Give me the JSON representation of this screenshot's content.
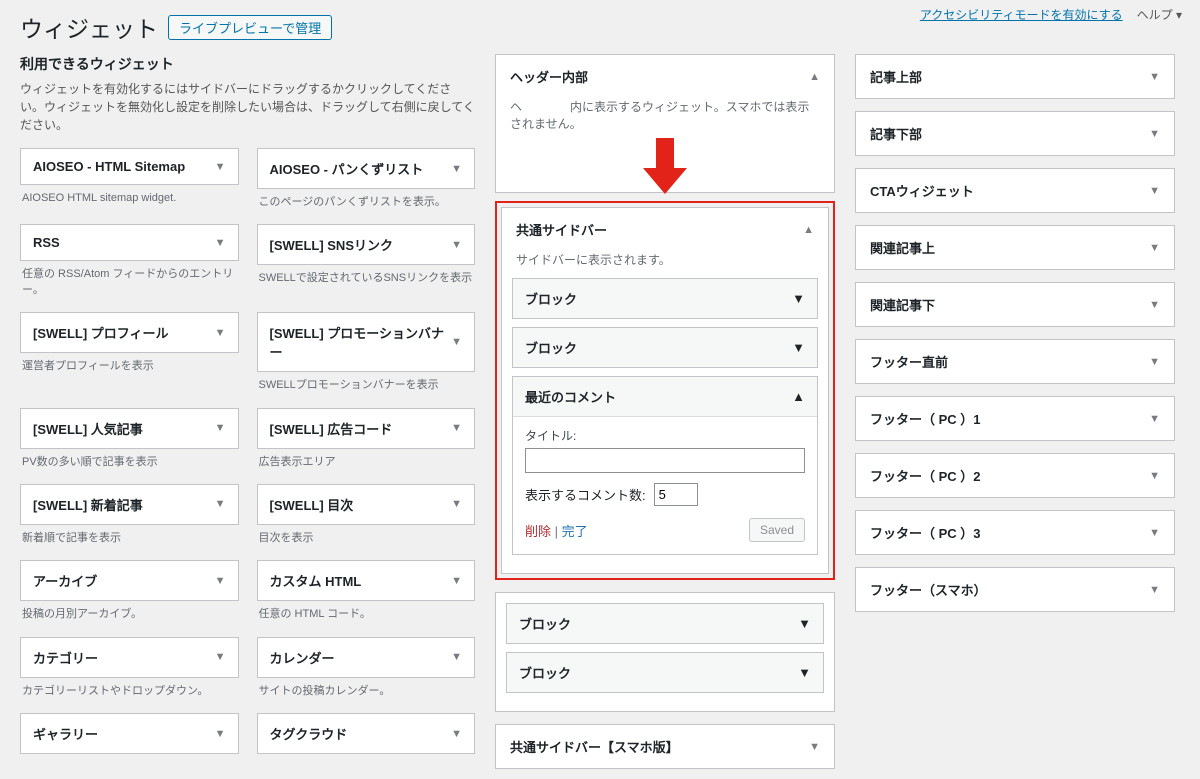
{
  "top": {
    "title": "ウィジェット",
    "live_preview": "ライブプレビューで管理",
    "a11y": "アクセシビリティモードを有効にする",
    "help": "ヘルプ ▾"
  },
  "left": {
    "subtitle": "利用できるウィジェット",
    "desc": "ウィジェットを有効化するにはサイドバーにドラッグするかクリックしてください。ウィジェットを無効化し設定を削除したい場合は、ドラッグして右側に戻してください。",
    "items": [
      {
        "label": "AIOSEO - HTML Sitemap",
        "desc": "AIOSEO HTML sitemap widget."
      },
      {
        "label": "AIOSEO - パンくずリスト",
        "desc": "このページのパンくずリストを表示。"
      },
      {
        "label": "RSS",
        "desc": "任意の RSS/Atom フィードからのエントリー。"
      },
      {
        "label": "[SWELL] SNSリンク",
        "desc": "SWELLで設定されているSNSリンクを表示"
      },
      {
        "label": "[SWELL] プロフィール",
        "desc": "運営者プロフィールを表示"
      },
      {
        "label": "[SWELL] プロモーションバナー",
        "desc": "SWELLプロモーションバナーを表示"
      },
      {
        "label": "[SWELL] 人気記事",
        "desc": "PV数の多い順で記事を表示"
      },
      {
        "label": "[SWELL] 広告コード",
        "desc": "広告表示エリア"
      },
      {
        "label": "[SWELL] 新着記事",
        "desc": "新着順で記事を表示"
      },
      {
        "label": "[SWELL] 目次",
        "desc": "目次を表示"
      },
      {
        "label": "アーカイブ",
        "desc": "投稿の月別アーカイブ。"
      },
      {
        "label": "カスタム HTML",
        "desc": "任意の HTML コード。"
      },
      {
        "label": "カテゴリー",
        "desc": "カテゴリーリストやドロップダウン。"
      },
      {
        "label": "カレンダー",
        "desc": "サイトの投稿カレンダー。"
      },
      {
        "label": "ギャラリー",
        "desc": ""
      },
      {
        "label": "タグクラウド",
        "desc": ""
      }
    ]
  },
  "mid": {
    "area0": {
      "title": "ヘッダー内部",
      "desc": "ヘ　　　　内に表示するウィジェット。スマホでは表示されません。"
    },
    "area1": {
      "title": "共通サイドバー",
      "desc": "サイドバーに表示されます。",
      "w0": "ブロック",
      "w1": "ブロック",
      "w2": {
        "title": "最近のコメント",
        "title_label": "タイトル:",
        "count_label": "表示するコメント数:",
        "count_value": "5",
        "delete": "削除",
        "done": "完了",
        "saved": "Saved"
      },
      "w3": "ブロック",
      "w4": "ブロック"
    },
    "area2": {
      "title": "共通サイドバー【スマホ版】"
    }
  },
  "right": {
    "areas": [
      "記事上部",
      "記事下部",
      "CTAウィジェット",
      "関連記事上",
      "関連記事下",
      "フッター直前",
      "フッター（ PC ）1",
      "フッター（ PC ）2",
      "フッター（ PC ）3",
      "フッター（スマホ）"
    ]
  }
}
